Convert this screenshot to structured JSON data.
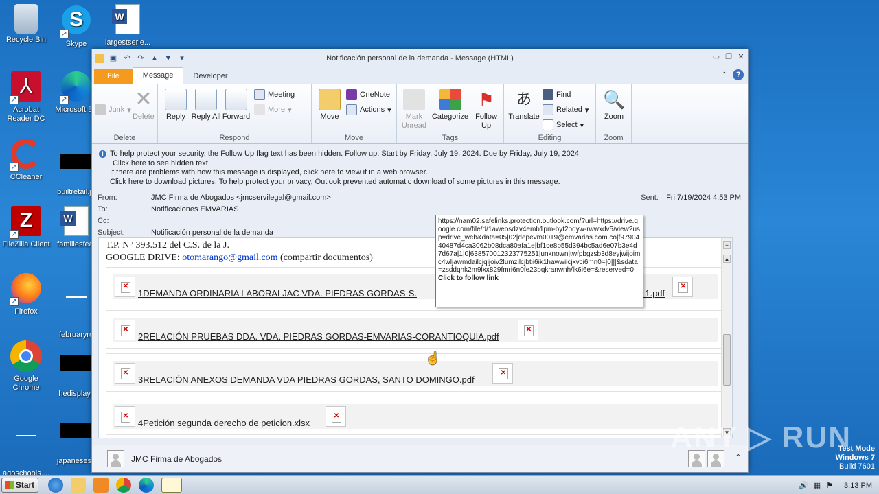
{
  "desktop": {
    "icons": [
      {
        "label": "Recycle Bin"
      },
      {
        "label": "Skype"
      },
      {
        "label": "largestserie..."
      },
      {
        "label": "Acrobat Reader DC"
      },
      {
        "label": "Microsoft Ed"
      },
      {
        "label": "CCleaner"
      },
      {
        "label": "builtretail.jp"
      },
      {
        "label": "FileZilla Client"
      },
      {
        "label": "familiesfeat"
      },
      {
        "label": "Firefox"
      },
      {
        "label": "februaryre"
      },
      {
        "label": "Google Chrome"
      },
      {
        "label": "hedisplay.j"
      },
      {
        "label": "agoschools...."
      },
      {
        "label": "japanesesu"
      }
    ]
  },
  "window": {
    "title": "Notificación personal de la demanda  -  Message (HTML)",
    "tabs": [
      "File",
      "Message",
      "Developer"
    ],
    "ribbon": {
      "delete": {
        "label": "Delete",
        "junk": "Junk",
        "delete_btn": "Delete"
      },
      "respond": {
        "label": "Respond",
        "reply": "Reply",
        "reply_all": "Reply All",
        "forward": "Forward",
        "meeting": "Meeting",
        "more": "More"
      },
      "move": {
        "label": "Move",
        "move_btn": "Move",
        "onenote": "OneNote",
        "actions": "Actions"
      },
      "tags": {
        "label": "Tags",
        "mark_unread": "Mark Unread",
        "categorize": "Categorize",
        "follow_up": "Follow Up"
      },
      "editing": {
        "label": "Editing",
        "translate": "Translate",
        "find": "Find",
        "related": "Related",
        "select": "Select"
      },
      "zoom": {
        "label": "Zoom",
        "zoom_btn": "Zoom"
      }
    },
    "infobar": {
      "line1": "To help protect your security, the Follow Up flag text has been hidden. Follow up.  Start by Friday, July 19, 2024.  Due by Friday, July 19, 2024.",
      "line2": "Click here to see hidden text.",
      "line3": "If there are problems with how this message is displayed, click here to view it in a web browser.",
      "line4": "Click here to download pictures. To help protect your privacy, Outlook prevented automatic download of some pictures in this message."
    },
    "headers": {
      "from_label": "From:",
      "from": "JMC Firma de Abogados <jmcservilegal@gmail.com>",
      "to_label": "To:",
      "to": "Notificaciones EMVARIAS",
      "cc_label": "Cc:",
      "cc": "",
      "subject_label": "Subject:",
      "subject": "Notificación personal de la demanda",
      "sent_label": "Sent:",
      "sent": "Fri 7/19/2024 4:53 PM"
    },
    "body": {
      "line1": "T.P. N° 393.512 del C.S. de la J.",
      "drive_prefix": "GOOGLE DRIVE: ",
      "drive_email": "otomarango@gmail.com",
      "drive_suffix": " (compartir documentos)",
      "attachments": [
        {
          "name": "1DEMANDA ORDINARIA LABORALJAC VDA. PIEDRAS GORDAS-S.",
          "tail": "f 1.pdf"
        },
        {
          "name": "2RELACIÓN PRUEBAS DDA. VDA. PIEDRAS GORDAS-EMVARIAS-CORANTIOQUIA.pdf"
        },
        {
          "name": "3RELACIÓN ANEXOS DEMANDA VDA PIEDRAS GORDAS, SANTO DOMINGO.pdf"
        },
        {
          "name": "4Petición segunda derecho de peticion.xlsx"
        }
      ]
    },
    "tooltip": {
      "url": "https://nam02.safelinks.protection.outlook.com/?url=https://drive.google.com/file/d/1aweosdzv4emb1pm-byt2odyw-rwwxdv5/view?usp=drive_web&data=05|02|depevm0019@emvarias.com.co|f9790440487d4ca3062b08dca80afa1e|bf1ce8b55d394bc5ad6e07b3e4d7d67a|1|0|638570012323775251|unknown|twfpbgzsb3d8eyjwijoimc4wljawmdailcjqijoiv2lumzilcjbtii6ik1hawwilcjxvci6mn0=|0|||&sdata=zsddqhk2m9lxx829fmri6n0fe23bqkranwnh/lk6i6e=&reserved=0",
      "action": "Click to follow link"
    },
    "people_pane": {
      "name": "JMC Firma de Abogados"
    }
  },
  "taskbar": {
    "start": "Start",
    "time": "3:13 PM"
  },
  "watermark": {
    "text": "ANY ▷ RUN"
  },
  "testmode": {
    "line1": "Test Mode",
    "line2": "Windows 7",
    "line3": "Build 7601"
  }
}
